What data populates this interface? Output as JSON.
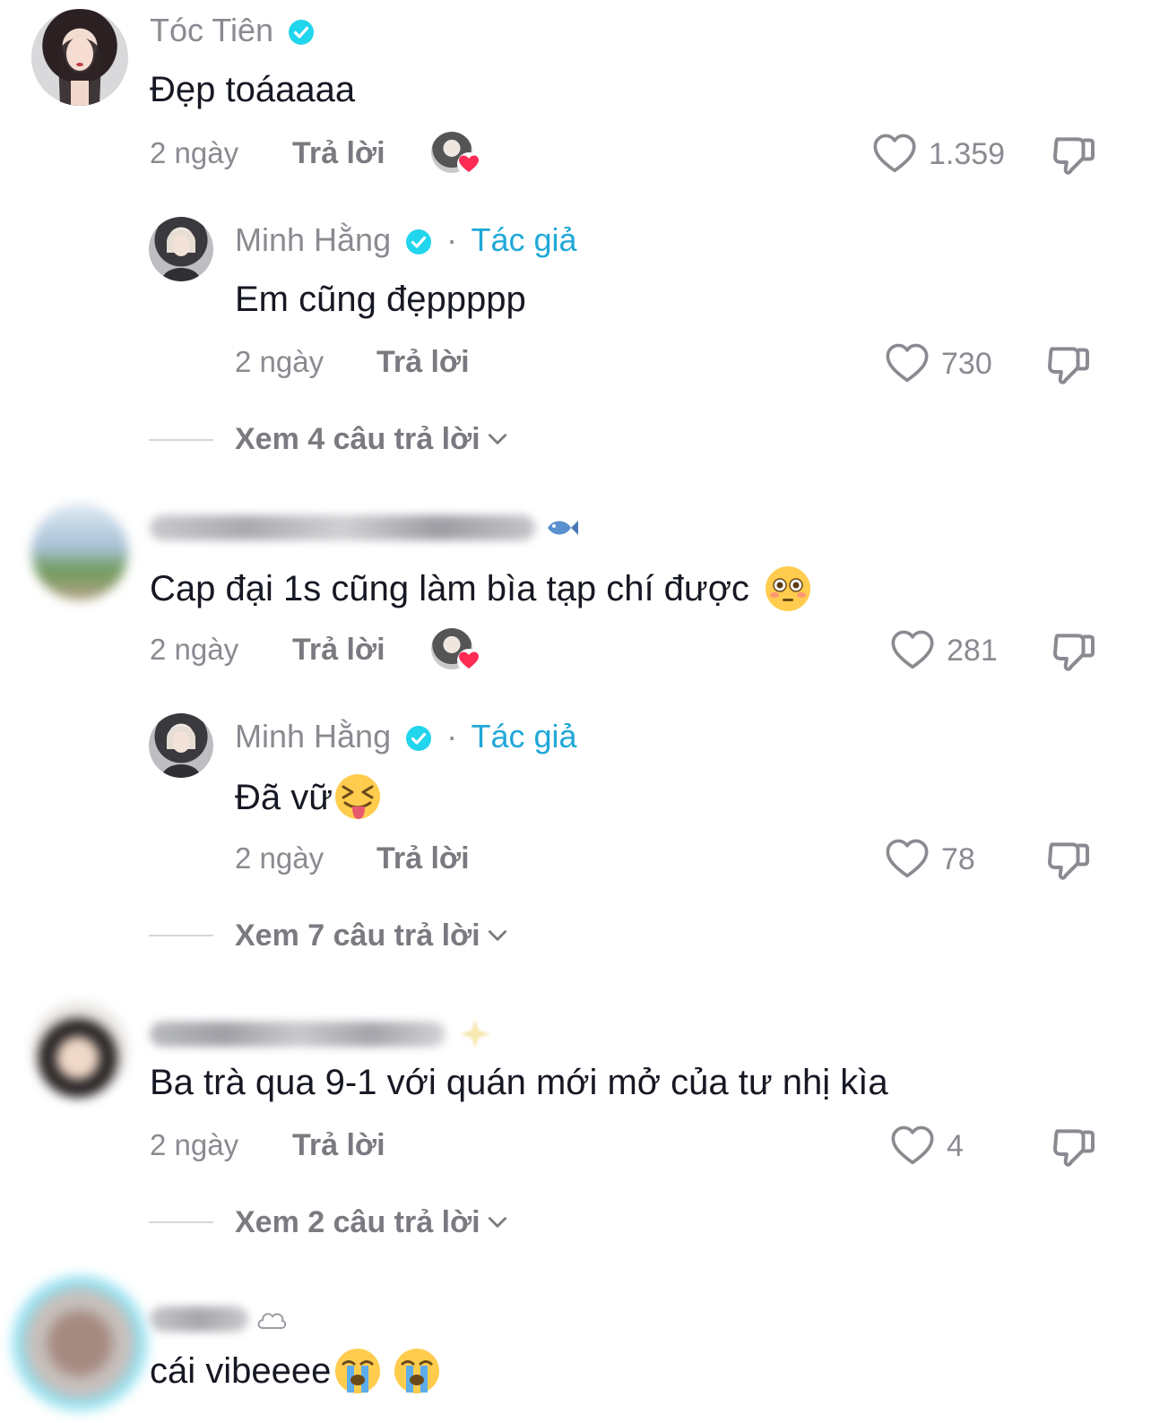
{
  "comments": [
    {
      "user": "Tóc Tiên",
      "text": "Đẹp toáaaaa",
      "time": "2 ngày",
      "reply_label": "Trả lời",
      "likes": "1.359",
      "reply": {
        "user": "Minh Hằng",
        "author_tag": "Tác giả",
        "separator": "·",
        "text": "Em cũng đẹppppp",
        "time": "2 ngày",
        "reply_label": "Trả lời",
        "likes": "730"
      },
      "view_more": "Xem 4 câu trả lời"
    },
    {
      "text": "Cap đại 1s cũng làm bìa tạp chí được",
      "time": "2 ngày",
      "reply_label": "Trả lời",
      "likes": "281",
      "reply": {
        "user": "Minh Hằng",
        "author_tag": "Tác giả",
        "separator": "·",
        "text": "Đã vữ",
        "time": "2 ngày",
        "reply_label": "Trả lời",
        "likes": "78"
      },
      "view_more": "Xem 7 câu trả lời"
    },
    {
      "text": "Ba trà qua 9-1 với quán mới mở của tư nhị kìa",
      "time": "2 ngày",
      "reply_label": "Trả lời",
      "likes": "4",
      "view_more": "Xem 2 câu trả lời"
    },
    {
      "text": "cái vibeeee"
    }
  ],
  "colors": {
    "author_tag": "#20a8d8",
    "verified": "#20d5ec",
    "heart": "#fe2c55",
    "meta": "#8a8b91"
  }
}
